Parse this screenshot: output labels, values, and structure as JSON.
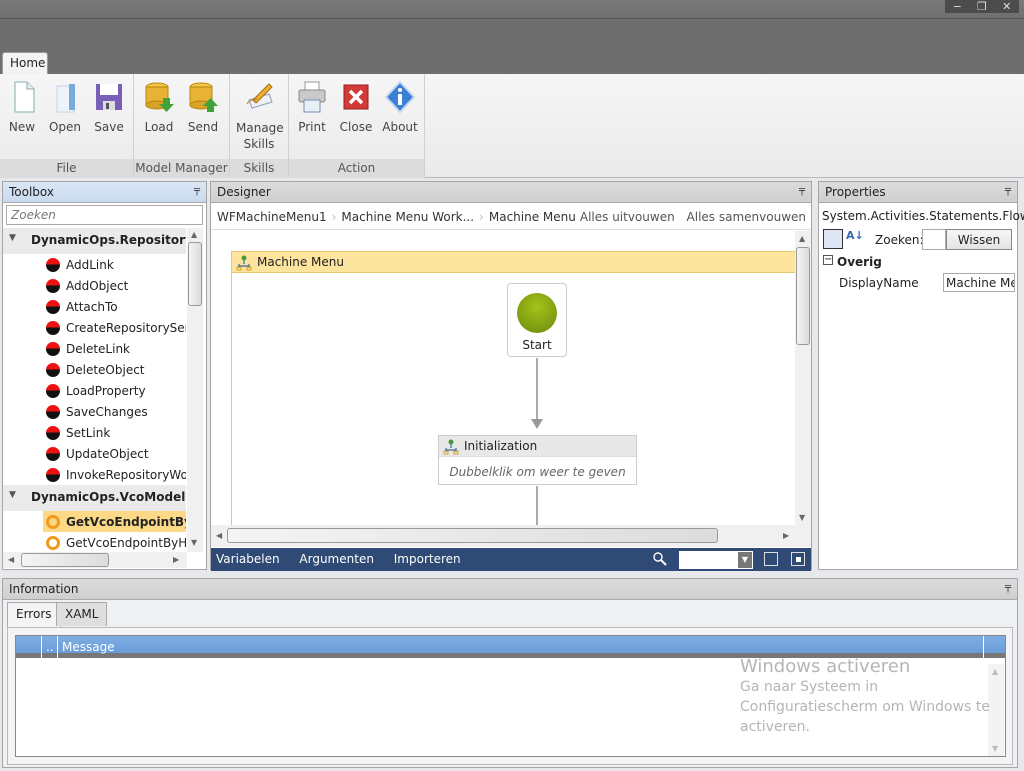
{
  "window": {
    "buttons": [
      "minimize",
      "restore",
      "close"
    ],
    "minimize_glyph": "−",
    "restore_glyph": "❐",
    "close_glyph": "✕"
  },
  "ribbon": {
    "tab": "Home",
    "groups": [
      {
        "label": "File",
        "buttons": [
          {
            "label": "New",
            "icon": "new-document-icon"
          },
          {
            "label": "Open",
            "icon": "open-folder-icon"
          },
          {
            "label": "Save",
            "icon": "floppy-disk-icon"
          }
        ]
      },
      {
        "label": "Model Manager",
        "buttons": [
          {
            "label": "Load",
            "icon": "database-download-icon"
          },
          {
            "label": "Send",
            "icon": "database-upload-icon"
          }
        ]
      },
      {
        "label": "Skills",
        "buttons": [
          {
            "label": "Manage Skills",
            "icon": "pencil-note-icon"
          }
        ]
      },
      {
        "label": "Action",
        "buttons": [
          {
            "label": "Print",
            "icon": "printer-icon"
          },
          {
            "label": "Close",
            "icon": "red-x-icon"
          },
          {
            "label": "About",
            "icon": "info-diamond-icon"
          }
        ]
      }
    ]
  },
  "toolbox": {
    "title": "Toolbox",
    "pin_glyph": "📌",
    "search_placeholder": "Zoeken",
    "categories": [
      {
        "name": "DynamicOps.Repository",
        "items": [
          "AddLink",
          "AddObject",
          "AttachTo",
          "CreateRepositoryServi",
          "DeleteLink",
          "DeleteObject",
          "LoadProperty",
          "SaveChanges",
          "SetLink",
          "UpdateObject",
          "InvokeRepositoryWork"
        ]
      },
      {
        "name": "DynamicOps.VcoModel.Act",
        "items": [
          "GetVcoEndpointByM",
          "GetVcoEndpointByHos"
        ],
        "selected": "GetVcoEndpointByM"
      }
    ]
  },
  "designer": {
    "title": "Designer",
    "breadcrumbs": [
      "WFMachineMenu1",
      "Machine Menu Work...",
      "Machine Menu"
    ],
    "crumb_sep": "›",
    "expand_all": "Alles uitvouwen",
    "collapse_all": "Alles samenvouwen",
    "flowchart_title": "Machine Menu",
    "start_label": "Start",
    "activity_title": "Initialization",
    "activity_hint": "Dubbelklik om weer te geven",
    "bottom_links": [
      "Variabelen",
      "Argumenten",
      "Importeren"
    ],
    "zoom_value": ""
  },
  "properties": {
    "title": "Properties",
    "type_name": "System.Activities.Statements.Flow...",
    "search_label": "Zoeken:",
    "search_value": "",
    "clear_button": "Wissen",
    "category": "Overig",
    "rows": [
      {
        "name": "DisplayName",
        "value": "Machine Mer"
      }
    ]
  },
  "information": {
    "title": "Information",
    "tabs": [
      "Errors",
      "XAML"
    ],
    "active_tab": "Errors",
    "columns": [
      "",
      "..",
      "Message"
    ]
  },
  "watermark": {
    "title": "Windows activeren",
    "line1": "Ga naar Systeem in",
    "line2": "Configuratiescherm om Windows te",
    "line3": "activeren."
  }
}
